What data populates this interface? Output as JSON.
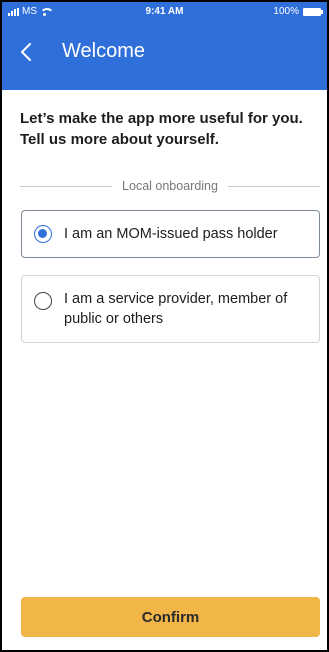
{
  "status_bar": {
    "carrier": "MS",
    "time": "9:41 AM",
    "battery": "100%"
  },
  "header": {
    "title": "Welcome",
    "back_icon": "chevron-left-icon"
  },
  "intro": {
    "text": "Let’s make the app more useful for you. Tell us more about yourself."
  },
  "section": {
    "label": "Local onboarding"
  },
  "options": [
    {
      "label": "I am an MOM-issued pass holder",
      "selected": true
    },
    {
      "label": "I am a service provider, member of public or others",
      "selected": false
    }
  ],
  "footer": {
    "confirm_label": "Confirm"
  },
  "colors": {
    "primary": "#2f6fd9",
    "accent": "#f2b548",
    "border": "#cfd4da"
  }
}
